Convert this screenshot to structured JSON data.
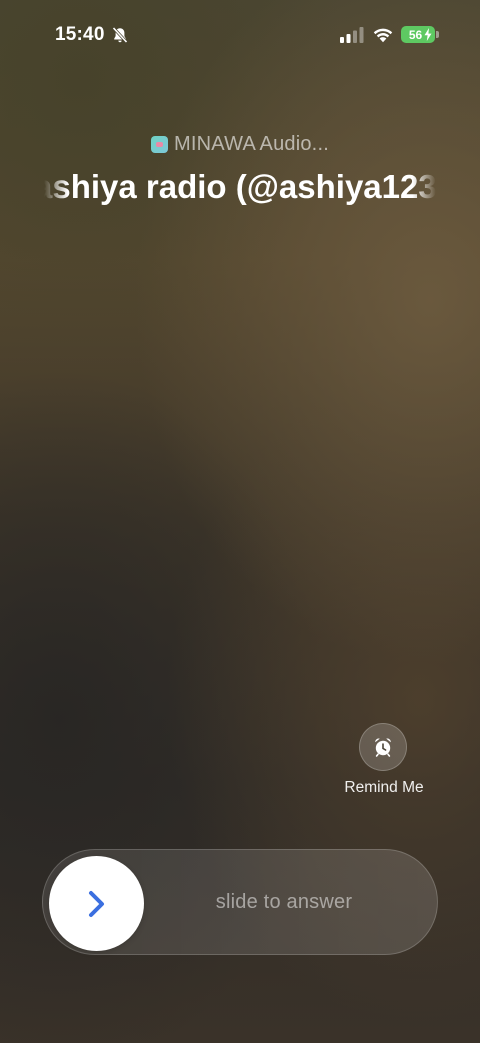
{
  "status_bar": {
    "time": "15:40",
    "silent_icon": "bell-slash-icon",
    "signal_icon": "cellular-signal-icon",
    "wifi_icon": "wifi-icon",
    "battery_level": "56",
    "battery_charging": true,
    "battery_color": "#5ec962"
  },
  "call": {
    "app_icon": "minawa-app-icon",
    "app_name": "MINAWA Audio...",
    "caller_name": "ashiya radio (@ashiya123"
  },
  "remind": {
    "icon": "alarm-clock-icon",
    "label": "Remind Me"
  },
  "slider": {
    "knob_icon": "chevron-right-icon",
    "label": "slide to answer",
    "accent_color": "#3b6fe0"
  }
}
